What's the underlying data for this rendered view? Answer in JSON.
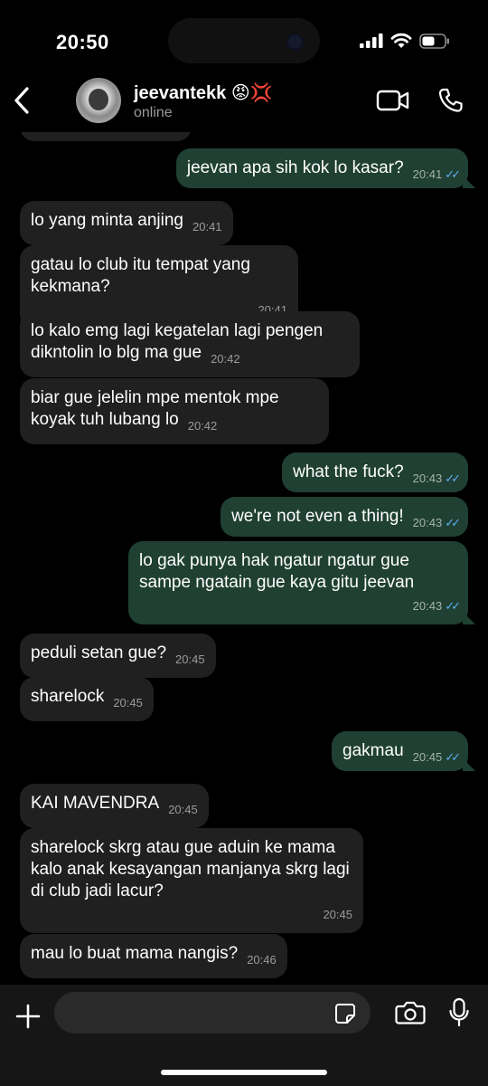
{
  "status_bar": {
    "time": "20:50"
  },
  "header": {
    "contact_name": "jeevantekk 😡💢",
    "status": "online"
  },
  "messages": [
    {
      "dir": "out",
      "text": "jeevan apa sih kok lo kasar?",
      "time": "20:41"
    },
    {
      "dir": "in",
      "text": "lo yang minta anjing",
      "time": "20:41"
    },
    {
      "dir": "in",
      "text": "gatau lo club itu tempat yang kekmana?",
      "time": "20:41"
    },
    {
      "dir": "in",
      "text": "lo kalo emg lagi kegatelan lagi pengen dikntolin lo blg ma gue",
      "time": "20:42"
    },
    {
      "dir": "in",
      "text": "biar gue jelelin mpe mentok mpe koyak tuh lubang lo",
      "time": "20:42"
    },
    {
      "dir": "out",
      "text": "what the fuck?",
      "time": "20:43"
    },
    {
      "dir": "out",
      "text": "we're not even a thing!",
      "time": "20:43"
    },
    {
      "dir": "out",
      "text": "lo gak punya hak ngatur ngatur gue sampe ngatain gue kaya gitu jeevan",
      "time": "20:43"
    },
    {
      "dir": "in",
      "text": "peduli setan gue?",
      "time": "20:45"
    },
    {
      "dir": "in",
      "text": "sharelock",
      "time": "20:45"
    },
    {
      "dir": "out",
      "text": "gakmau",
      "time": "20:45"
    },
    {
      "dir": "in",
      "text": "KAI MAVENDRA",
      "time": "20:45"
    },
    {
      "dir": "in",
      "text": "sharelock skrg atau gue aduin ke mama kalo anak kesayangan manjanya skrg lagi di club jadi lacur?",
      "time": "20:45"
    },
    {
      "dir": "in",
      "text": "mau lo buat mama nangis?",
      "time": "20:46"
    }
  ],
  "input": {
    "placeholder": ""
  },
  "colors": {
    "incoming_bubble": "#202020",
    "outgoing_bubble": "#1f4032",
    "read_ticks": "#60b0f0"
  },
  "icons": [
    "back-chevron-icon",
    "video-call-icon",
    "phone-icon",
    "plus-icon",
    "sticker-icon",
    "camera-icon",
    "microphone-icon"
  ]
}
